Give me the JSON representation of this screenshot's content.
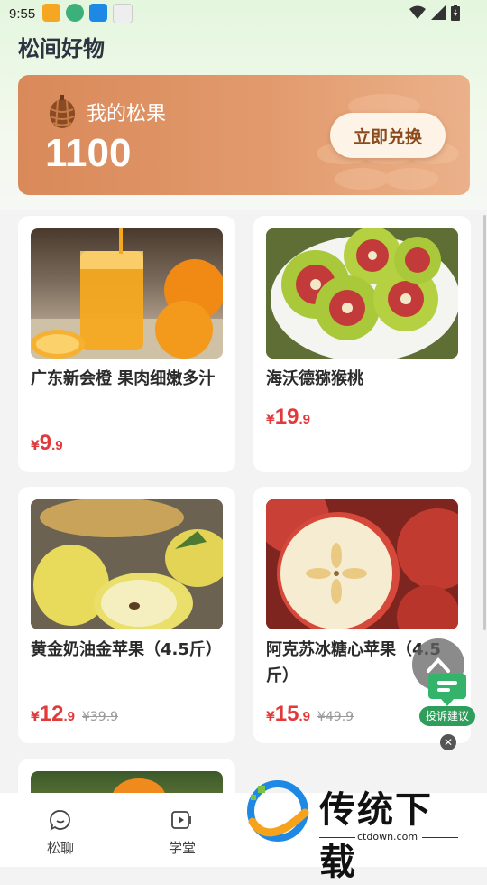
{
  "status": {
    "time": "9:55"
  },
  "page": {
    "title": "松间好物"
  },
  "banner": {
    "label": "我的松果",
    "points": "1100",
    "redeem_label": "立即兑换"
  },
  "products": [
    {
      "name": "广东新会橙 果肉细嫩多汁",
      "currency": "¥",
      "price_int": "9",
      "price_dec": ".9",
      "old_price": ""
    },
    {
      "name": "海沃德猕猴桃",
      "currency": "¥",
      "price_int": "19",
      "price_dec": ".9",
      "old_price": ""
    },
    {
      "name": "黄金奶油金苹果（4.5斤）",
      "currency": "¥",
      "price_int": "12",
      "price_dec": ".9",
      "old_price": "¥39.9"
    },
    {
      "name": "阿克苏冰糖心苹果（4.5斤）",
      "currency": "¥",
      "price_int": "15",
      "price_dec": ".9",
      "old_price": "¥49.9"
    }
  ],
  "nav": {
    "items": [
      {
        "label": "松聊"
      },
      {
        "label": "学堂"
      }
    ]
  },
  "feedback": {
    "label": "投诉建议"
  },
  "watermark": {
    "brand": "传统下载",
    "url": "ctdown.com"
  },
  "colors": {
    "accent": "#e23a3a",
    "banner": "#e29a6c",
    "feedback": "#2e9e5a"
  }
}
